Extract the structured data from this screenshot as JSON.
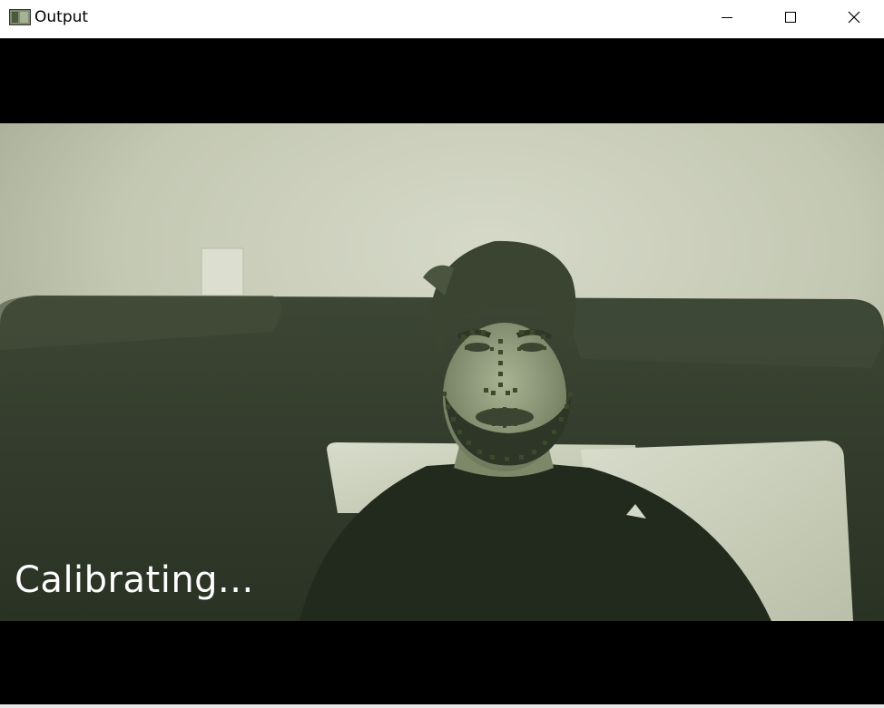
{
  "window": {
    "title": "Output",
    "icons": {
      "app": "app-window-icon",
      "minimize": "minimize-icon",
      "maximize": "maximize-icon",
      "close": "close-icon"
    }
  },
  "video": {
    "status_text": "Calibrating...",
    "tint": "#c8cdb8",
    "landmark_color": "#3a4a2a"
  }
}
